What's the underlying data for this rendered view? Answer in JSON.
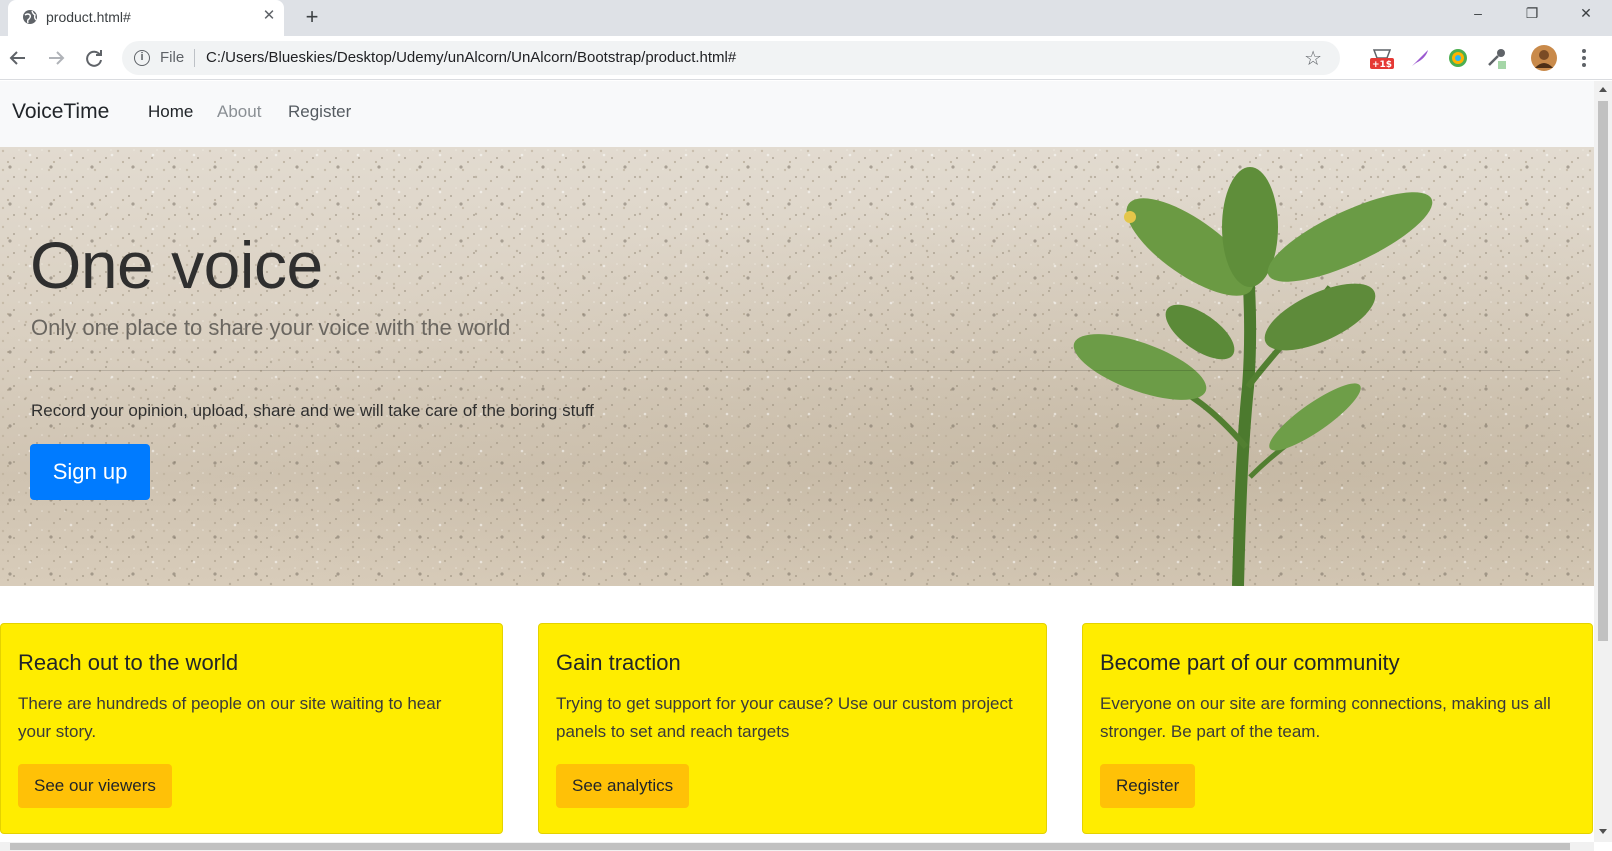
{
  "browser": {
    "tab_title": "product.html#",
    "tab_close": "✕",
    "new_tab": "+",
    "scheme_label": "File",
    "url": "C:/Users/Blueskies/Desktop/Udemy/unAlcorn/UnAlcorn/Bootstrap/product.html#",
    "extension_badge": "+1$",
    "window_controls": [
      "–",
      "❐",
      "✕"
    ]
  },
  "navbar": {
    "brand": "VoiceTime",
    "links": [
      {
        "label": "Home",
        "color": "#212529"
      },
      {
        "label": "About",
        "color": "#8a8f94"
      },
      {
        "label": "Register",
        "color": "#555b61"
      }
    ]
  },
  "hero": {
    "title": "One voice",
    "subtitle": "Only one place to share your voice with the world",
    "text": "Record your opinion, upload, share and we will take care of the boring stuff",
    "button": "Sign up"
  },
  "cards": [
    {
      "title": "Reach out to the world",
      "text": "There are hundreds of people on our site waiting to hear your story.",
      "button": "See our viewers"
    },
    {
      "title": "Gain traction",
      "text": "Trying to get support for your cause? Use our custom project panels to set and reach targets",
      "button": "See analytics"
    },
    {
      "title": "Become part of our community",
      "text": "Everyone on our site are forming connections, making us all stronger. Be part of the team.",
      "button": "Register"
    }
  ],
  "colors": {
    "primary": "#007bff",
    "card_yellow": "#ffed00",
    "button_warning": "#ffc107",
    "navbar_bg": "#f8f9fa"
  }
}
